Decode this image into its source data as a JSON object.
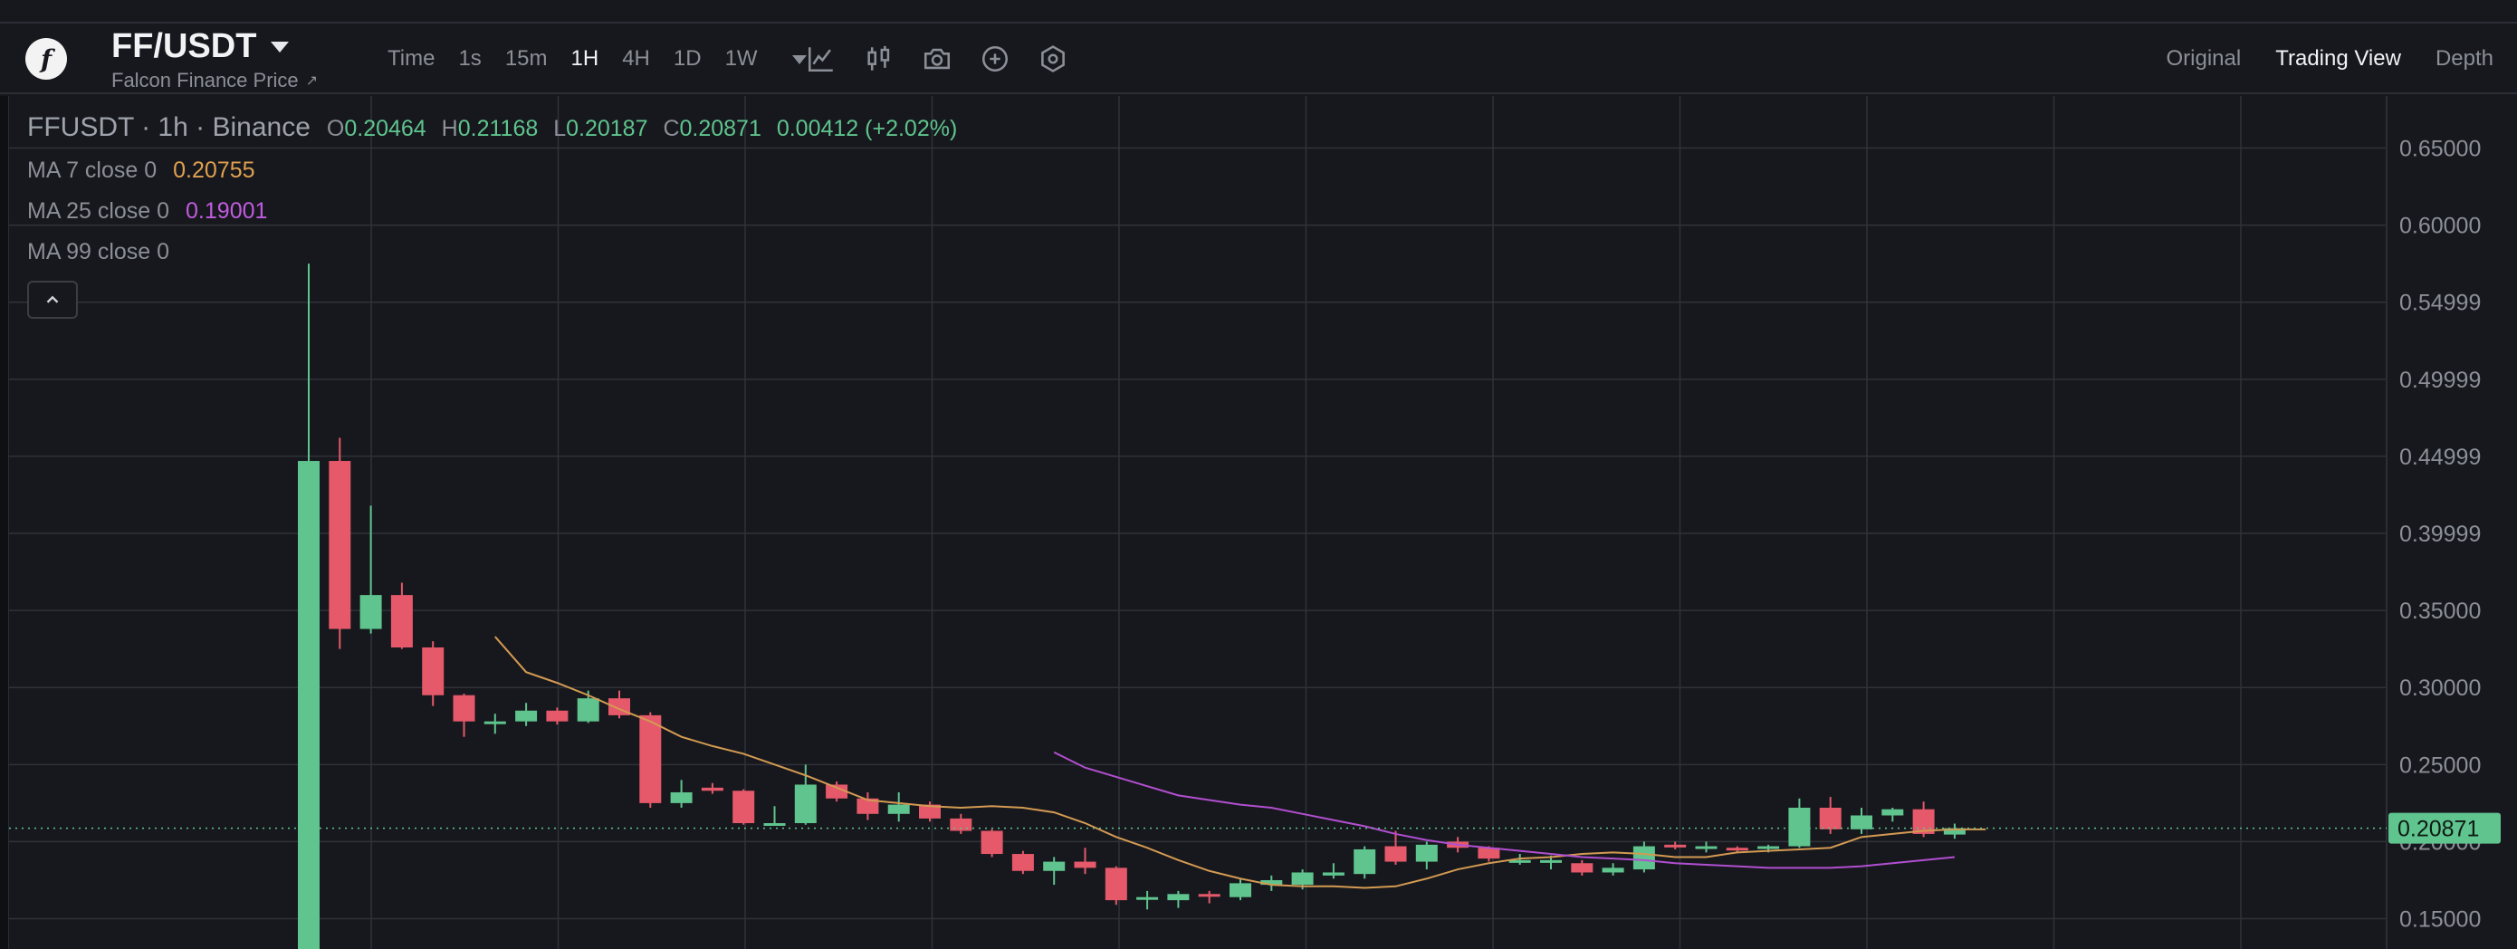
{
  "header": {
    "pair": "FF/USDT",
    "subtitle": "Falcon Finance Price",
    "subtitle_ext": "↗",
    "intervals": [
      "Time",
      "1s",
      "15m",
      "1H",
      "4H",
      "1D",
      "1W"
    ],
    "active_interval": "1H",
    "views": [
      "Original",
      "Trading View",
      "Depth"
    ],
    "active_view": "Trading View",
    "tools": [
      "line-chart-icon",
      "candles-icon",
      "camera-icon",
      "plus-circle-icon",
      "settings-hex-icon"
    ]
  },
  "legend": {
    "symbol": "FFUSDT · 1h · Binance",
    "o_label": "O",
    "o": "0.20464",
    "h_label": "H",
    "h": "0.21168",
    "l_label": "L",
    "l": "0.20187",
    "c_label": "C",
    "c": "0.20871",
    "change": "0.00412 (+2.02%)",
    "ma7_label": "MA 7 close 0",
    "ma7_value": "0.20755",
    "ma25_label": "MA 25 close 0",
    "ma25_value": "0.19001",
    "ma99_label": "MA 99 close 0"
  },
  "colors": {
    "up": "#5fc48e",
    "down": "#e5596a",
    "ma7": "#d39a52",
    "ma25": "#b14fd0",
    "grid": "#2f323a",
    "bg": "#17181d"
  },
  "chart_data": {
    "type": "candlestick",
    "y_ticks": [
      "0.65000",
      "0.60000",
      "0.54999",
      "0.49999",
      "0.44999",
      "0.39999",
      "0.35000",
      "0.30000",
      "0.25000",
      "0.20000",
      "0.15000"
    ],
    "ylim": [
      0.117,
      0.665
    ],
    "last_price": "0.20871",
    "candles": [
      {
        "o": 0.117,
        "h": 0.575,
        "l": 0.117,
        "c": 0.447
      },
      {
        "o": 0.447,
        "h": 0.462,
        "l": 0.325,
        "c": 0.338
      },
      {
        "o": 0.338,
        "h": 0.418,
        "l": 0.335,
        "c": 0.36
      },
      {
        "o": 0.36,
        "h": 0.368,
        "l": 0.325,
        "c": 0.326
      },
      {
        "o": 0.326,
        "h": 0.33,
        "l": 0.288,
        "c": 0.295
      },
      {
        "o": 0.295,
        "h": 0.296,
        "l": 0.268,
        "c": 0.278
      },
      {
        "o": 0.278,
        "h": 0.283,
        "l": 0.27,
        "c": 0.278
      },
      {
        "o": 0.278,
        "h": 0.29,
        "l": 0.275,
        "c": 0.285
      },
      {
        "o": 0.285,
        "h": 0.287,
        "l": 0.276,
        "c": 0.278
      },
      {
        "o": 0.278,
        "h": 0.298,
        "l": 0.277,
        "c": 0.293
      },
      {
        "o": 0.293,
        "h": 0.298,
        "l": 0.28,
        "c": 0.282
      },
      {
        "o": 0.282,
        "h": 0.284,
        "l": 0.222,
        "c": 0.225
      },
      {
        "o": 0.225,
        "h": 0.24,
        "l": 0.222,
        "c": 0.232
      },
      {
        "o": 0.235,
        "h": 0.238,
        "l": 0.231,
        "c": 0.233
      },
      {
        "o": 0.233,
        "h": 0.234,
        "l": 0.211,
        "c": 0.212
      },
      {
        "o": 0.212,
        "h": 0.223,
        "l": 0.211,
        "c": 0.212
      },
      {
        "o": 0.212,
        "h": 0.25,
        "l": 0.211,
        "c": 0.237
      },
      {
        "o": 0.237,
        "h": 0.239,
        "l": 0.226,
        "c": 0.228
      },
      {
        "o": 0.228,
        "h": 0.232,
        "l": 0.214,
        "c": 0.218
      },
      {
        "o": 0.218,
        "h": 0.232,
        "l": 0.213,
        "c": 0.224
      },
      {
        "o": 0.224,
        "h": 0.226,
        "l": 0.213,
        "c": 0.215
      },
      {
        "o": 0.215,
        "h": 0.218,
        "l": 0.205,
        "c": 0.207
      },
      {
        "o": 0.207,
        "h": 0.208,
        "l": 0.19,
        "c": 0.192
      },
      {
        "o": 0.192,
        "h": 0.194,
        "l": 0.179,
        "c": 0.181
      },
      {
        "o": 0.181,
        "h": 0.19,
        "l": 0.172,
        "c": 0.187
      },
      {
        "o": 0.187,
        "h": 0.196,
        "l": 0.179,
        "c": 0.183
      },
      {
        "o": 0.183,
        "h": 0.184,
        "l": 0.159,
        "c": 0.162
      },
      {
        "o": 0.164,
        "h": 0.168,
        "l": 0.156,
        "c": 0.164
      },
      {
        "o": 0.162,
        "h": 0.168,
        "l": 0.157,
        "c": 0.166
      },
      {
        "o": 0.166,
        "h": 0.168,
        "l": 0.16,
        "c": 0.165
      },
      {
        "o": 0.164,
        "h": 0.176,
        "l": 0.162,
        "c": 0.173
      },
      {
        "o": 0.172,
        "h": 0.178,
        "l": 0.168,
        "c": 0.175
      },
      {
        "o": 0.172,
        "h": 0.182,
        "l": 0.169,
        "c": 0.18
      },
      {
        "o": 0.178,
        "h": 0.186,
        "l": 0.176,
        "c": 0.18
      },
      {
        "o": 0.179,
        "h": 0.197,
        "l": 0.176,
        "c": 0.195
      },
      {
        "o": 0.197,
        "h": 0.207,
        "l": 0.185,
        "c": 0.187
      },
      {
        "o": 0.187,
        "h": 0.2,
        "l": 0.182,
        "c": 0.198
      },
      {
        "o": 0.2,
        "h": 0.203,
        "l": 0.193,
        "c": 0.196
      },
      {
        "o": 0.196,
        "h": 0.197,
        "l": 0.187,
        "c": 0.189
      },
      {
        "o": 0.188,
        "h": 0.192,
        "l": 0.185,
        "c": 0.188
      },
      {
        "o": 0.188,
        "h": 0.191,
        "l": 0.182,
        "c": 0.188
      },
      {
        "o": 0.186,
        "h": 0.188,
        "l": 0.178,
        "c": 0.18
      },
      {
        "o": 0.18,
        "h": 0.186,
        "l": 0.178,
        "c": 0.183
      },
      {
        "o": 0.182,
        "h": 0.2,
        "l": 0.18,
        "c": 0.197
      },
      {
        "o": 0.198,
        "h": 0.2,
        "l": 0.195,
        "c": 0.197
      },
      {
        "o": 0.197,
        "h": 0.2,
        "l": 0.193,
        "c": 0.197
      },
      {
        "o": 0.196,
        "h": 0.197,
        "l": 0.193,
        "c": 0.195
      },
      {
        "o": 0.196,
        "h": 0.198,
        "l": 0.193,
        "c": 0.197
      },
      {
        "o": 0.197,
        "h": 0.228,
        "l": 0.196,
        "c": 0.222
      },
      {
        "o": 0.222,
        "h": 0.229,
        "l": 0.205,
        "c": 0.208
      },
      {
        "o": 0.208,
        "h": 0.222,
        "l": 0.205,
        "c": 0.217
      },
      {
        "o": 0.217,
        "h": 0.222,
        "l": 0.213,
        "c": 0.221
      },
      {
        "o": 0.221,
        "h": 0.226,
        "l": 0.203,
        "c": 0.205
      },
      {
        "o": 0.2046,
        "h": 0.2117,
        "l": 0.2019,
        "c": 0.2087
      }
    ],
    "ma7": [
      0.333,
      0.31,
      0.303,
      0.295,
      0.286,
      0.278,
      0.268,
      0.262,
      0.257,
      0.25,
      0.243,
      0.235,
      0.227,
      0.225,
      0.223,
      0.222,
      0.223,
      0.222,
      0.219,
      0.212,
      0.203,
      0.196,
      0.188,
      0.181,
      0.176,
      0.172,
      0.171,
      0.171,
      0.17,
      0.171,
      0.176,
      0.182,
      0.186,
      0.189,
      0.19,
      0.192,
      0.193,
      0.192,
      0.19,
      0.19,
      0.193,
      0.194,
      0.195,
      0.196,
      0.203,
      0.205,
      0.207,
      0.208,
      0.208
    ],
    "ma25": [
      0.258,
      0.248,
      0.242,
      0.236,
      0.23,
      0.227,
      0.224,
      0.222,
      0.218,
      0.214,
      0.21,
      0.205,
      0.201,
      0.198,
      0.196,
      0.194,
      0.192,
      0.19,
      0.189,
      0.188,
      0.186,
      0.185,
      0.184,
      0.183,
      0.183,
      0.183,
      0.184,
      0.186,
      0.188,
      0.19
    ]
  }
}
